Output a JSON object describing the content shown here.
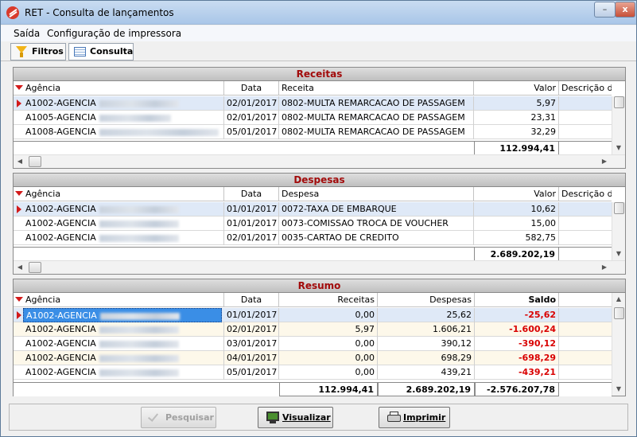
{
  "window": {
    "title": "RET - Consulta de lançamentos",
    "minimize_glyph": "–",
    "close_glyph": "x"
  },
  "menu": {
    "items": [
      "Saída",
      "Configuração de impressora"
    ]
  },
  "tabs": {
    "filtros": "Filtros",
    "consulta": "Consulta"
  },
  "receitas": {
    "title": "Receitas",
    "columns": {
      "agencia": "Agência",
      "data": "Data",
      "item": "Receita",
      "valor": "Valor",
      "descricao": "Descrição de"
    },
    "rows": [
      {
        "agencia": "A1002-AGENCIA",
        "data": "02/01/2017",
        "item": "0802-MULTA REMARCACAO DE PASSAGEM",
        "valor": "5,97"
      },
      {
        "agencia": "A1005-AGENCIA",
        "data": "02/01/2017",
        "item": "0802-MULTA REMARCACAO DE PASSAGEM",
        "valor": "23,31"
      },
      {
        "agencia": "A1008-AGENCIA",
        "data": "05/01/2017",
        "item": "0802-MULTA REMARCACAO DE PASSAGEM",
        "valor": "32,29"
      }
    ],
    "total": "112.994,41"
  },
  "despesas": {
    "title": "Despesas",
    "columns": {
      "agencia": "Agência",
      "data": "Data",
      "item": "Despesa",
      "valor": "Valor",
      "descricao": "Descrição de"
    },
    "rows": [
      {
        "agencia": "A1002-AGENCIA",
        "data": "01/01/2017",
        "item": "0072-TAXA DE EMBARQUE",
        "valor": "10,62"
      },
      {
        "agencia": "A1002-AGENCIA",
        "data": "01/01/2017",
        "item": "0073-COMISSAO TROCA DE VOUCHER",
        "valor": "15,00"
      },
      {
        "agencia": "A1002-AGENCIA",
        "data": "02/01/2017",
        "item": "0035-CARTAO DE CREDITO",
        "valor": "582,75"
      }
    ],
    "total": "2.689.202,19"
  },
  "resumo": {
    "title": "Resumo",
    "columns": {
      "agencia": "Agência",
      "data": "Data",
      "receitas": "Receitas",
      "despesas": "Despesas",
      "saldo": "Saldo"
    },
    "rows": [
      {
        "agencia": "A1002-AGENCIA",
        "data": "01/01/2017",
        "receitas": "0,00",
        "despesas": "25,62",
        "saldo": "-25,62"
      },
      {
        "agencia": "A1002-AGENCIA",
        "data": "02/01/2017",
        "receitas": "5,97",
        "despesas": "1.606,21",
        "saldo": "-1.600,24"
      },
      {
        "agencia": "A1002-AGENCIA",
        "data": "03/01/2017",
        "receitas": "0,00",
        "despesas": "390,12",
        "saldo": "-390,12"
      },
      {
        "agencia": "A1002-AGENCIA",
        "data": "04/01/2017",
        "receitas": "0,00",
        "despesas": "698,29",
        "saldo": "-698,29"
      },
      {
        "agencia": "A1002-AGENCIA",
        "data": "05/01/2017",
        "receitas": "0,00",
        "despesas": "439,21",
        "saldo": "-439,21"
      }
    ],
    "totals": {
      "receitas": "112.994,41",
      "despesas": "2.689.202,19",
      "saldo": "-2.576.207,78"
    }
  },
  "actions": {
    "pesquisar": "Pesquisar",
    "visualizar": "Visualizar",
    "imprimir": "Imprimir"
  },
  "colors": {
    "title_red": "#a20b0b",
    "negative_red": "#d90000",
    "selected_row": "#dfe9f7",
    "alt_row": "#fdf8ea"
  },
  "icons": {
    "app": "app-logo-icon",
    "filter": "funnel-icon",
    "grid": "grid-icon",
    "pesquisar": "checkmark-icon",
    "visualizar": "monitor-icon",
    "imprimir": "printer-icon"
  }
}
